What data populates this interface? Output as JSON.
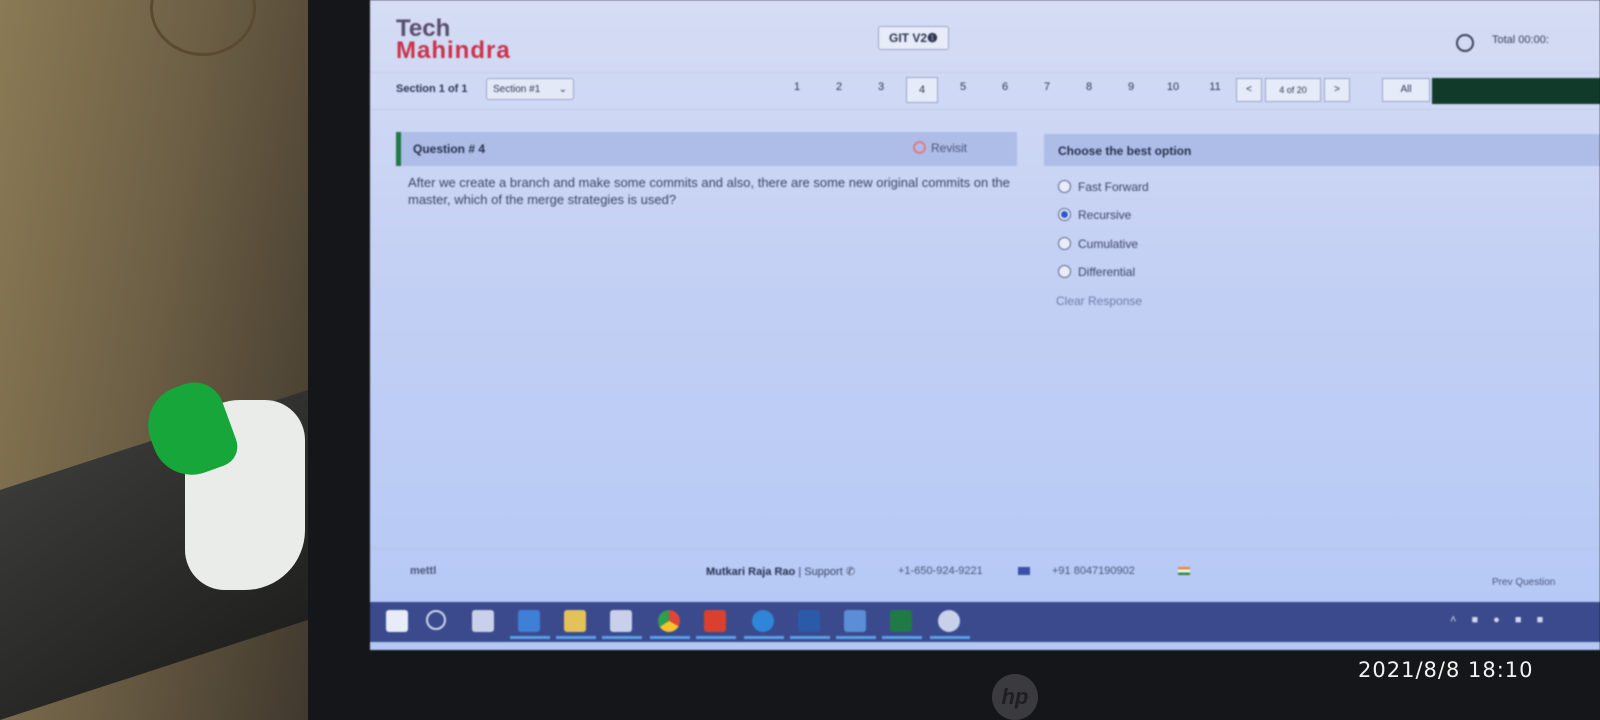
{
  "logo": {
    "line1": "Tech",
    "line2": "Mahindra"
  },
  "header": {
    "test_name": "GIT V2❶",
    "timer": "Total 00:00:"
  },
  "nav": {
    "section_text": "Section 1 of 1",
    "section_select": "Section #1",
    "question_numbers": [
      "1",
      "2",
      "3",
      "4",
      "5",
      "6",
      "7",
      "8",
      "9",
      "10",
      "11"
    ],
    "current_question": "4",
    "prev_symbol": "<",
    "page_indicator": "4 of 20",
    "next_symbol": ">",
    "all_label": "All"
  },
  "question": {
    "title": "Question # 4",
    "revisit_label": "Revisit",
    "text": "After we create a branch and make some commits and also, there are some new original commits on the master, which of the merge strategies is used?"
  },
  "answers": {
    "title": "Choose the best option",
    "options": [
      {
        "label": "Fast Forward",
        "selected": false
      },
      {
        "label": "Recursive",
        "selected": true
      },
      {
        "label": "Cumulative",
        "selected": false
      },
      {
        "label": "Differential",
        "selected": false
      }
    ],
    "clear_label": "Clear Response"
  },
  "footer": {
    "left_logo": "mettl",
    "candidate_name": "Mutkari Raja Rao",
    "support_label": "| Support",
    "phone1": "+1-650-924-9221",
    "phone2": "+91 8047190902",
    "prev_label": "Prev Question"
  },
  "colors": {
    "logo_tech": "#5a4e6c",
    "logo_mahindra": "#c9334b",
    "section_header": "#aebde7",
    "accent_green": "#1f7a46",
    "taskbar": "#3a4a8c",
    "bottle_cap": "#17a63a"
  },
  "taskbar_icons": [
    "start-icon",
    "search-icon",
    "task-view-icon",
    "app-icon",
    "file-explorer-icon",
    "app-icon",
    "chrome-icon",
    "office-icon",
    "edge-icon",
    "word-icon",
    "app-icon",
    "excel-icon",
    "app-icon"
  ],
  "photo_timestamp": "2021/8/8 18:10",
  "laptop_brand": "hp"
}
